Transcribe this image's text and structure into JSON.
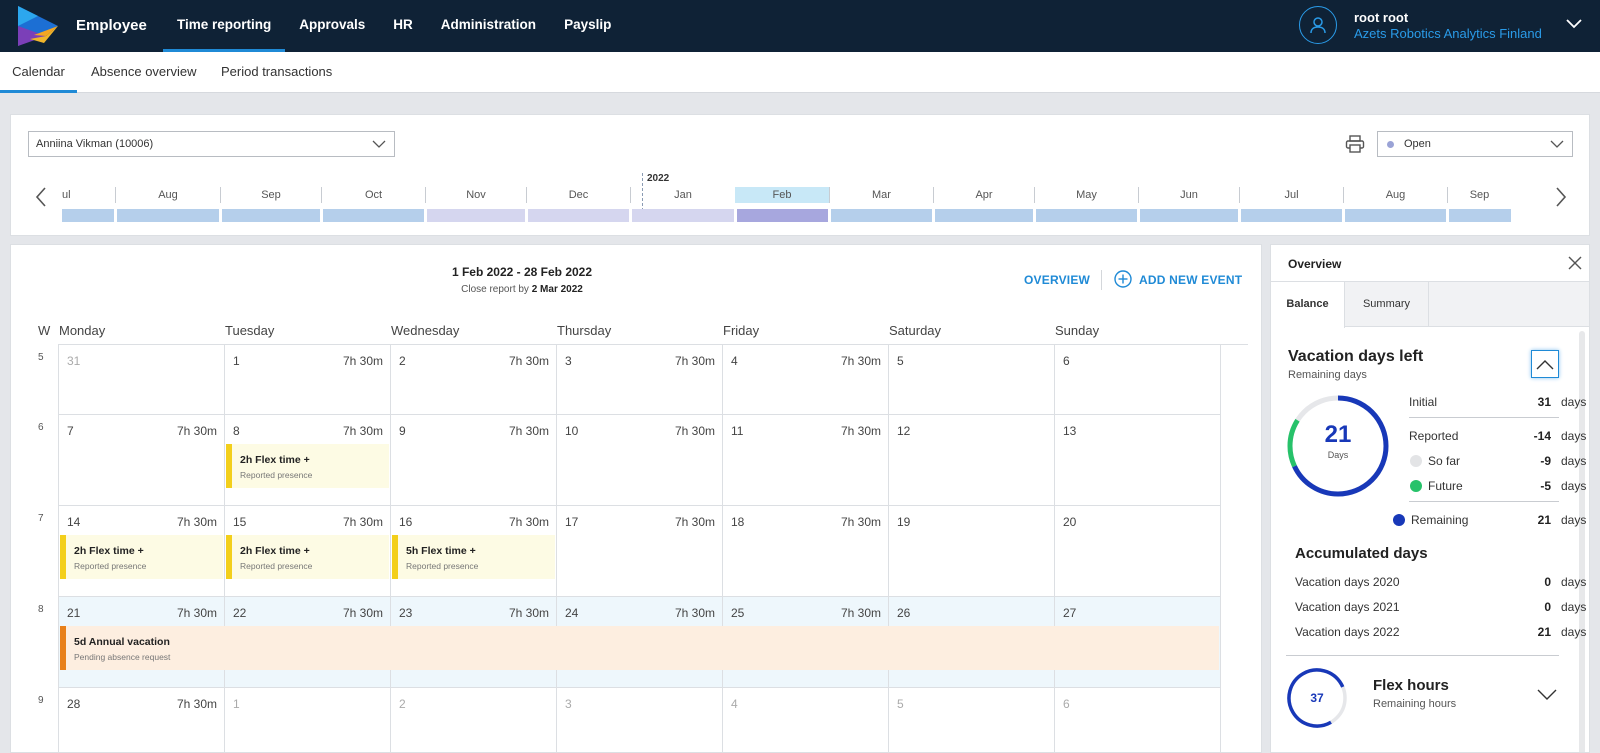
{
  "app": {
    "name": "Employee"
  },
  "nav": {
    "items": [
      "Time reporting",
      "Approvals",
      "HR",
      "Administration",
      "Payslip"
    ]
  },
  "user": {
    "name": "root root",
    "company": "Azets Robotics Analytics Finland"
  },
  "subtabs": [
    "Calendar",
    "Absence overview",
    "Period transactions"
  ],
  "period": {
    "employee": "Anniina Vikman (10006)",
    "status": "Open",
    "year_label": "2022",
    "months": [
      "ul",
      "Aug",
      "Sep",
      "Oct",
      "Nov",
      "Dec",
      "Jan",
      "Feb",
      "Mar",
      "Apr",
      "May",
      "Jun",
      "Jul",
      "Aug",
      "Sep"
    ],
    "selected_month": "Feb"
  },
  "calendar": {
    "range": "1 Feb 2022 - 28 Feb 2022",
    "close_prefix": "Close report by ",
    "close_date": "2 Mar 2022",
    "overview_link": "OVERVIEW",
    "add_event": "ADD NEW EVENT",
    "week_label": "W",
    "day_headers": [
      "Monday",
      "Tuesday",
      "Wednesday",
      "Thursday",
      "Friday",
      "Saturday",
      "Sunday"
    ],
    "weeks": [
      {
        "no": "5",
        "days": [
          {
            "d": "31",
            "h": "",
            "mut": true
          },
          {
            "d": "1",
            "h": "7h 30m"
          },
          {
            "d": "2",
            "h": "7h 30m"
          },
          {
            "d": "3",
            "h": "7h 30m"
          },
          {
            "d": "4",
            "h": "7h 30m"
          },
          {
            "d": "5",
            "h": ""
          },
          {
            "d": "6",
            "h": ""
          }
        ]
      },
      {
        "no": "6",
        "days": [
          {
            "d": "7",
            "h": "7h 30m"
          },
          {
            "d": "8",
            "h": "7h 30m"
          },
          {
            "d": "9",
            "h": "7h 30m"
          },
          {
            "d": "10",
            "h": "7h 30m"
          },
          {
            "d": "11",
            "h": "7h 30m"
          },
          {
            "d": "12",
            "h": ""
          },
          {
            "d": "13",
            "h": ""
          }
        ]
      },
      {
        "no": "7",
        "days": [
          {
            "d": "14",
            "h": "7h 30m"
          },
          {
            "d": "15",
            "h": "7h 30m"
          },
          {
            "d": "16",
            "h": "7h 30m"
          },
          {
            "d": "17",
            "h": "7h 30m"
          },
          {
            "d": "18",
            "h": "7h 30m"
          },
          {
            "d": "19",
            "h": ""
          },
          {
            "d": "20",
            "h": ""
          }
        ]
      },
      {
        "no": "8",
        "days": [
          {
            "d": "21",
            "h": "7h 30m"
          },
          {
            "d": "22",
            "h": "7h 30m"
          },
          {
            "d": "23",
            "h": "7h 30m"
          },
          {
            "d": "24",
            "h": "7h 30m"
          },
          {
            "d": "25",
            "h": "7h 30m"
          },
          {
            "d": "26",
            "h": ""
          },
          {
            "d": "27",
            "h": ""
          }
        ]
      },
      {
        "no": "9",
        "days": [
          {
            "d": "28",
            "h": "7h 30m"
          },
          {
            "d": "1",
            "h": "",
            "mut": true
          },
          {
            "d": "2",
            "h": "",
            "mut": true
          },
          {
            "d": "3",
            "h": "",
            "mut": true
          },
          {
            "d": "4",
            "h": "",
            "mut": true
          },
          {
            "d": "5",
            "h": "",
            "mut": true
          },
          {
            "d": "6",
            "h": "",
            "mut": true
          }
        ]
      }
    ],
    "events": [
      {
        "title": "2h Flex time +",
        "sub": "Reported presence"
      },
      {
        "title": "2h Flex time +",
        "sub": "Reported presence"
      },
      {
        "title": "2h Flex time +",
        "sub": "Reported presence"
      },
      {
        "title": "5h Flex time +",
        "sub": "Reported presence"
      },
      {
        "title": "5d Annual vacation",
        "sub": "Pending absence request"
      }
    ]
  },
  "overview": {
    "title": "Overview",
    "tabs": [
      "Balance",
      "Summary"
    ],
    "vacation": {
      "title": "Vacation days left",
      "subtitle": "Remaining days",
      "center_value": "21",
      "center_label": "Days",
      "rows": [
        {
          "label": "Initial",
          "value": "31",
          "unit": "days"
        },
        {
          "label": "Reported",
          "value": "-14",
          "unit": "days"
        },
        {
          "label": "So far",
          "value": "-9",
          "unit": "days"
        },
        {
          "label": "Future",
          "value": "-5",
          "unit": "days"
        },
        {
          "label": "Remaining",
          "value": "21",
          "unit": "days"
        }
      ]
    },
    "accumulated": {
      "title": "Accumulated days",
      "rows": [
        {
          "label": "Vacation days 2020",
          "value": "0",
          "unit": "days"
        },
        {
          "label": "Vacation days 2021",
          "value": "0",
          "unit": "days"
        },
        {
          "label": "Vacation days 2022",
          "value": "21",
          "unit": "days"
        }
      ]
    },
    "flex": {
      "value": "37",
      "title": "Flex hours",
      "subtitle": "Remaining hours"
    }
  },
  "colors": {
    "navy": "#0f2236",
    "accent": "#1f8ad6",
    "flex_event": "#f3cf1b",
    "vacation_event": "#e8801a",
    "remaining": "#1838b8",
    "future": "#27c26a"
  }
}
